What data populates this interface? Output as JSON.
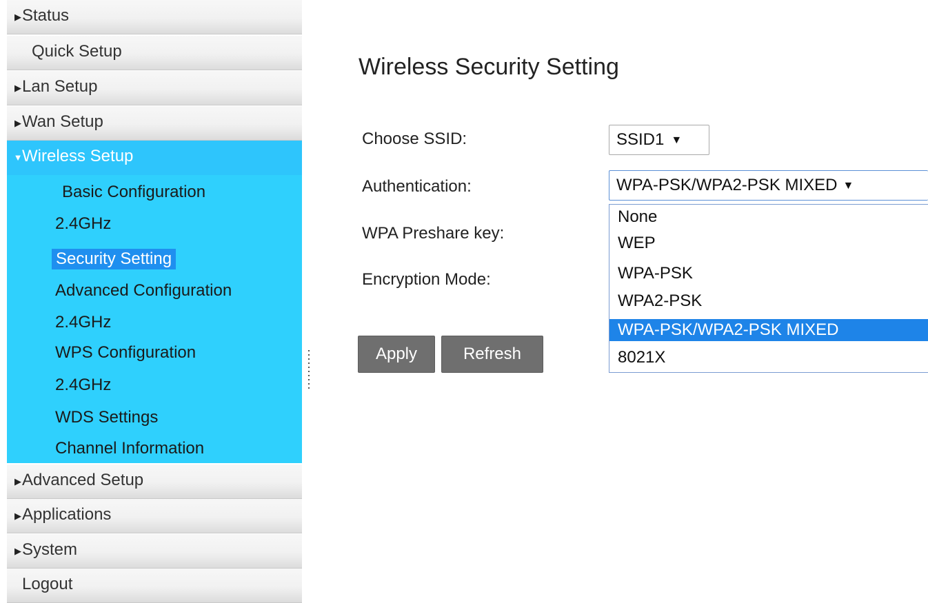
{
  "sidebar": {
    "items": [
      {
        "label": "Status",
        "arrow": "right"
      },
      {
        "label": "Quick Setup",
        "arrow": "none"
      },
      {
        "label": "Lan Setup",
        "arrow": "right"
      },
      {
        "label": "Wan Setup",
        "arrow": "right"
      },
      {
        "label": "Wireless Setup",
        "arrow": "down",
        "expanded": true
      },
      {
        "label": "Advanced Setup",
        "arrow": "right"
      },
      {
        "label": "Applications",
        "arrow": "right"
      },
      {
        "label": "System",
        "arrow": "right"
      },
      {
        "label": "Logout",
        "arrow": "none"
      }
    ],
    "wireless_submenu": {
      "basic_config": "Basic Configuration",
      "basic_config_band": "2.4GHz",
      "security_setting": "Security Setting",
      "advanced_config": "Advanced Configuration",
      "advanced_config_band": "2.4GHz",
      "wps_config": "WPS Configuration",
      "wps_config_band": "2.4GHz",
      "wds_settings": "WDS Settings",
      "channel_info": "Channel Information",
      "active": "Security Setting"
    },
    "arrow_right_glyph": "▶",
    "arrow_down_glyph": "▼"
  },
  "main": {
    "title": "Wireless Security Setting",
    "form": {
      "ssid_label": "Choose SSID:",
      "ssid_value": "SSID1",
      "auth_label": "Authentication:",
      "auth_value": "WPA-PSK/WPA2-PSK MIXED",
      "wpa_key_label": "WPA Preshare key:",
      "encryption_label": "Encryption Mode:"
    },
    "auth_options": [
      "None",
      "WEP",
      "WPA-PSK",
      "WPA2-PSK",
      "WPA-PSK/WPA2-PSK MIXED",
      "8021X"
    ],
    "auth_selected_index": 4,
    "buttons": {
      "apply": "Apply",
      "refresh": "Refresh"
    },
    "caret_glyph": "▼"
  },
  "colors": {
    "menu_active": "#2ec5fc",
    "submenu_bg": "#2fd0fd",
    "submenu_active": "#1f8fef",
    "option_selected": "#1e84e8",
    "button_bg": "#6f6f6f"
  }
}
